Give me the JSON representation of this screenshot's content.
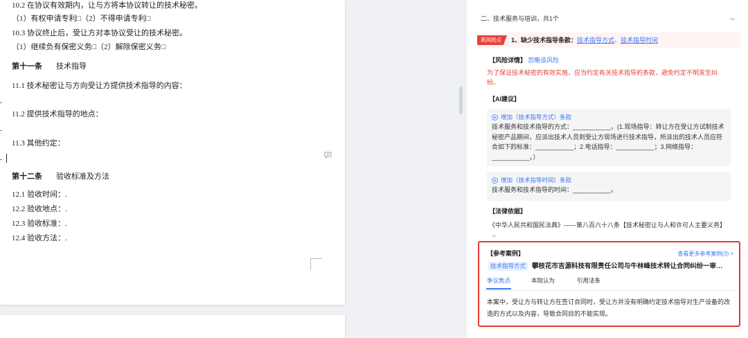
{
  "document": {
    "lines": [
      "10.2 在协议有效期内，让与方将本协议转让的技术秘密。",
      "（1）有权申请专利□（2）不得申请专利□",
      "10.3 协议终止后，受让方对本协议受让的技术秘密。",
      "（1）继续负有保密义务□（2）解除保密义务□"
    ],
    "article11": {
      "number": "第十一条",
      "title": "技术指导",
      "clauses": [
        "11.1 技术秘密让与方向受让方提供技术指导的内容：",
        "11.2 提供技术指导的地点：",
        "11.3 其他约定："
      ]
    },
    "article12": {
      "number": "第十二条",
      "title": "验收标准及方法",
      "clauses": [
        "12.1 验收时间：.",
        "12.2 验收地点：.",
        "12.3 验收标准：.",
        "12.4 验收方法：."
      ]
    },
    "comment_icon": "comment-icon"
  },
  "panel": {
    "section_title": "二、技术服务与培训，共1个",
    "section_toggle_icon": "chevron-down-icon",
    "risk": {
      "level_badge": "高风险点",
      "title": "1、缺少技术指导条款：",
      "missing_terms": [
        "技术指导方式",
        "技术指导时间"
      ],
      "term_separator": "、",
      "detail_label": "【风险详情】",
      "ignore_label": "忽略该风险",
      "detail_text": "为了保证技术秘密的有效实施，应当约定有关技术指导的条款，避免约定不明发生纠纷。",
      "ai_label": "【AI建议】",
      "suggestions": [
        {
          "icon": "plus-circle-icon",
          "title": "增加（技术指导方式）条款",
          "text": "技术服务和技术指导的方式：___________。(1.现场指导：转让方在受让方试制技术秘密产品期间，应派出技术人员到受让方现场进行技术指导，所派出的技术人员应符合如下的标准：___________；2.电话指导：___________；3.网络指导：___________。）"
        },
        {
          "icon": "plus-circle-icon",
          "title": "增加（技术指导时间）条款",
          "text": "技术服务和技术指导的时间：___________。"
        }
      ],
      "law_label": "【法律依据】",
      "law_text": "《中华人民共和国民法典》——第八百六十八条【技术秘密让与人和许可人主要义务】",
      "law_toggle_icon": "chevron-down-icon"
    },
    "reference_case": {
      "label": "【参考案例】",
      "more_link": "查看更多参考案例(3) >",
      "tag": "技术指导方式",
      "case_title": "攀枝花市吉源科技有限责任公司与牛林峰技术转让合同纠纷一审…",
      "tabs": [
        "争议焦点",
        "本院认为",
        "引用法条"
      ],
      "active_tab_index": 0,
      "content": "本案中，受让方与转让方在签订合同时，受让方并没有明确约定技术指导对生产设备的改造的方式以及内容，导致合同目的不能实现。"
    }
  },
  "colors": {
    "page_background": "#f0f1f4",
    "accent_blue": "#3b78f6",
    "risk_red": "#e8413a",
    "highlight_border": "#e53935"
  }
}
